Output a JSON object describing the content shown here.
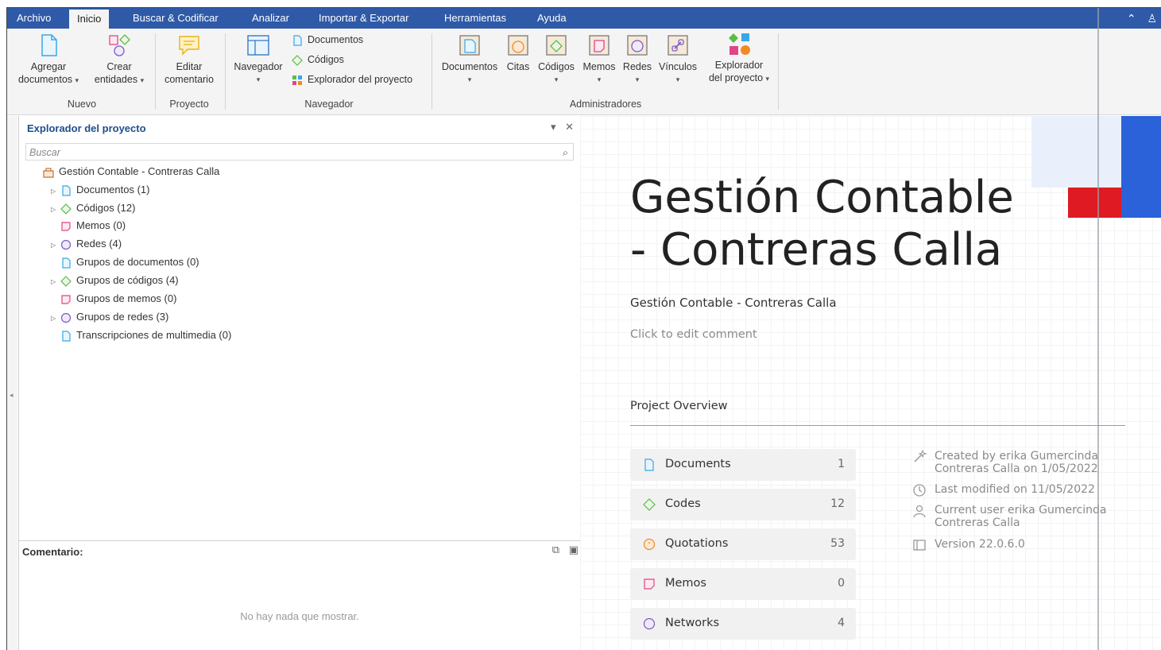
{
  "menu": {
    "tabs": [
      "Archivo",
      "Inicio",
      "Buscar & Codificar",
      "Analizar",
      "Importar & Exportar",
      "Herramientas",
      "Ayuda"
    ],
    "active_tab": "Inicio"
  },
  "ribbon": {
    "nuevo": {
      "agregar_l1": "Agregar",
      "agregar_l2": "documentos",
      "crear_l1": "Crear",
      "crear_l2": "entidades",
      "group": "Nuevo"
    },
    "proyecto": {
      "editar_l1": "Editar",
      "editar_l2": "comentario",
      "group": "Proyecto"
    },
    "navegador": {
      "navegador": "Navegador",
      "documentos": "Documentos",
      "codigos": "Códigos",
      "explorador": "Explorador del proyecto",
      "group": "Navegador"
    },
    "administradores": {
      "documentos": "Documentos",
      "citas": "Citas",
      "codigos": "Códigos",
      "memos": "Memos",
      "redes": "Redes",
      "vinculos": "Vínculos",
      "explorador_l1": "Explorador",
      "explorador_l2": "del proyecto",
      "group": "Administradores"
    }
  },
  "explorer": {
    "title": "Explorador del proyecto",
    "search_placeholder": "Buscar",
    "root": "Gestión Contable - Contreras Calla",
    "items": [
      {
        "label": "Documentos (1)"
      },
      {
        "label": "Códigos (12)"
      },
      {
        "label": "Memos (0)"
      },
      {
        "label": "Redes (4)"
      },
      {
        "label": "Grupos de documentos (0)"
      },
      {
        "label": "Grupos de códigos (4)"
      },
      {
        "label": "Grupos de memos (0)"
      },
      {
        "label": "Grupos de redes (3)"
      },
      {
        "label": "Transcripciones de multimedia (0)"
      }
    ],
    "comment_label": "Comentario:",
    "empty_message": "No hay nada que mostrar."
  },
  "project": {
    "title_line1": "Gestión Contable",
    "title_line2": "- Contreras Calla",
    "subtitle": "Gestión Contable - Contreras Calla",
    "edit_comment": "Click to edit comment",
    "overview_heading": "Project Overview",
    "stats": [
      {
        "label": "Documents",
        "value": "1"
      },
      {
        "label": "Codes",
        "value": "12"
      },
      {
        "label": "Quotations",
        "value": "53"
      },
      {
        "label": "Memos",
        "value": "0"
      },
      {
        "label": "Networks",
        "value": "4"
      }
    ],
    "meta": {
      "created_l1": "Created by erika Gumercinda",
      "created_l2": "Contreras Calla on 1/05/2022",
      "modified": "Last modified on 11/05/2022",
      "user_l1": "Current user erika Gumercinda",
      "user_l2": "Contreras Calla",
      "version": "Version 22.0.6.0"
    }
  },
  "colors": {
    "menubar": "#2e5aa8",
    "accent_blue": "#2b62d9",
    "accent_red": "#e01a22",
    "doc_icon": "#3aa6e8",
    "code_icon": "#5dbb46",
    "memo_icon": "#e0458a",
    "network_icon": "#7a5cc4",
    "quotation_icon": "#f08a24"
  }
}
